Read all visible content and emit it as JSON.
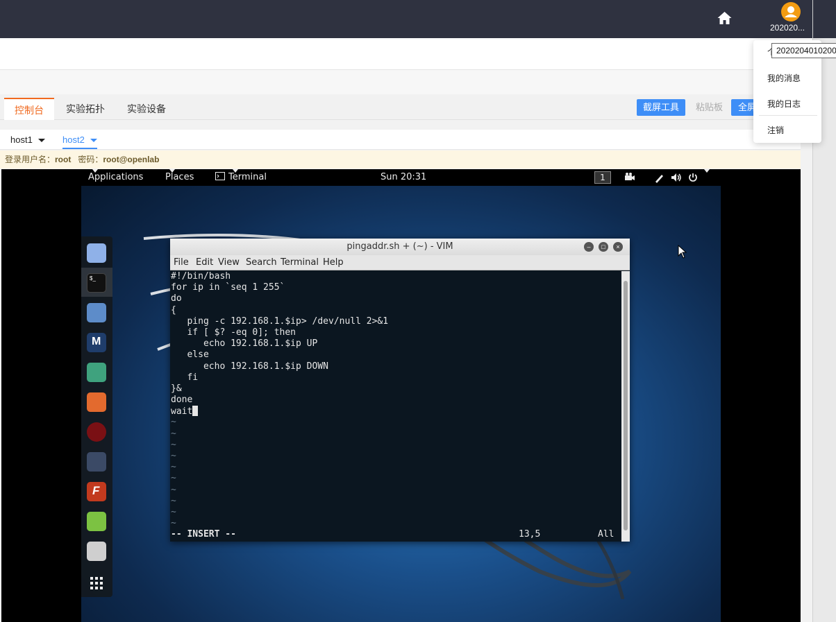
{
  "header": {
    "user_name": "202020...",
    "tooltip": "2020204010200",
    "colors": {
      "bar": "#2f3240",
      "avatar": "#f39c12",
      "accent": "#f06a1f",
      "primary": "#3e8ef7"
    }
  },
  "user_menu": {
    "items": [
      "个",
      "我的消息",
      "我的日志",
      "注销"
    ]
  },
  "tabs": {
    "items": [
      "控制台",
      "实验拓扑",
      "实验设备"
    ],
    "active": 0
  },
  "toolbar": {
    "screenshot_label": "截屏工具",
    "clipboard_label": "粘贴板",
    "fullscreen_label": "全屏"
  },
  "hosts": {
    "items": [
      "host1",
      "host2"
    ],
    "active": 1
  },
  "login_info": {
    "user_label": "登录用户名：",
    "user_value": "root",
    "password_label": "密码：",
    "password_value": "root@openlab"
  },
  "gnome": {
    "applications": "Applications",
    "places": "Places",
    "terminal": "Terminal",
    "clock": "Sun 20:31",
    "workspace": "1"
  },
  "terminal": {
    "title": "pingaddr.sh + (~) - VIM",
    "menu": [
      "File",
      "Edit",
      "View",
      "Search",
      "Terminal",
      "Help"
    ],
    "lines": [
      "#!/bin/bash",
      "for ip in `seq 1 255`",
      "do",
      "{",
      "   ping -c 192.168.1.$ip> /dev/null 2>&1",
      "   if [ $? -eq 0]; then",
      "      echo 192.168.1.$ip UP",
      "   else",
      "      echo 192.168.1.$ip DOWN",
      "   fi",
      "}&",
      "done",
      "wait"
    ],
    "tilde": "~",
    "tilde_count": 10,
    "mode": "-- INSERT --",
    "position": "13,5",
    "scroll": "All"
  }
}
